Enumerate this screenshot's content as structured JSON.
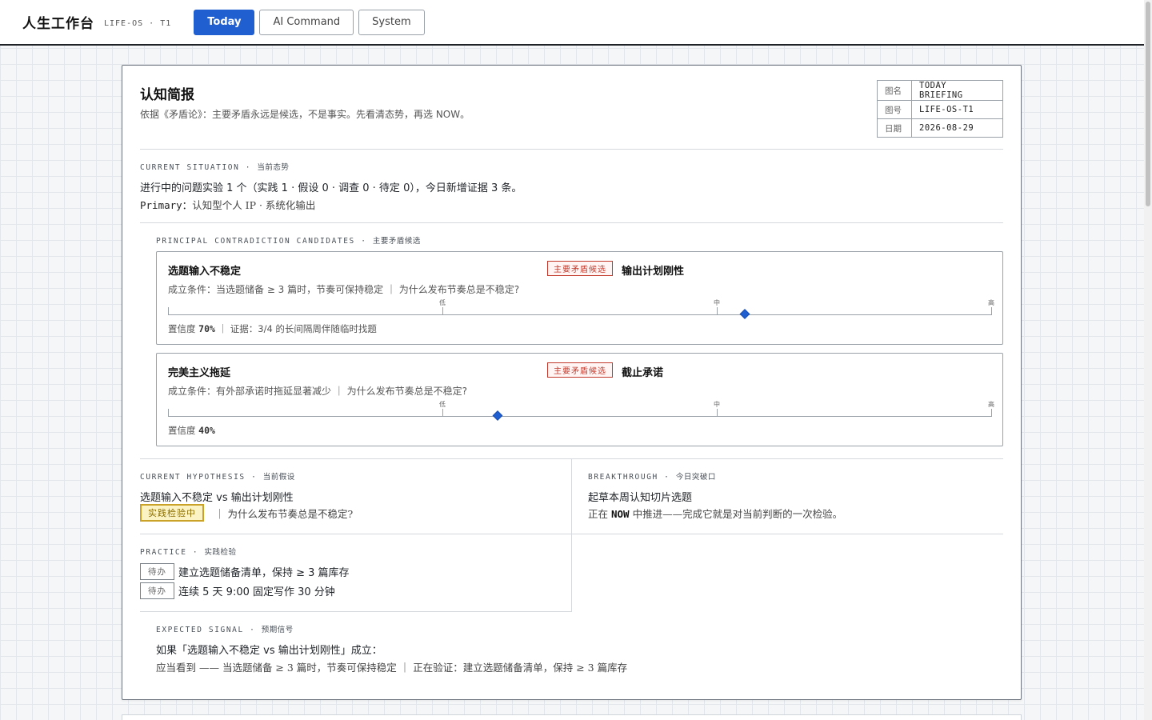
{
  "app": {
    "title": "人生工作台",
    "subtitle": "LIFE-OS · T1"
  },
  "tabs": [
    {
      "label": "Today",
      "active": true
    },
    {
      "label": "AI Command",
      "active": false
    },
    {
      "label": "System",
      "active": false
    }
  ],
  "briefing": {
    "title": "认知简报",
    "subtitle": "依据《矛盾论》：主要矛盾永远是候选，不是事实。先看清态势，再选 NOW。",
    "meta": [
      {
        "key": "图名",
        "value": "TODAY BRIEFING"
      },
      {
        "key": "图号",
        "value": "LIFE-OS-T1"
      },
      {
        "key": "日期",
        "value": "2026-08-29"
      }
    ]
  },
  "situation": {
    "label": "CURRENT SITUATION",
    "label_zh": "当前态势",
    "summary": "进行中的问题实验 1 个（实践 1 · 假设 0 · 调查 0 · 待定 0），今日新增证据 3 条。",
    "primary_key": "Primary：",
    "primary_value": "认知型个人 IP · 系统化输出"
  },
  "candidates": {
    "label": "PRINCIPAL CONTRADICTION CANDIDATES",
    "label_zh": "主要矛盾候选",
    "scale_labels": {
      "low": "低",
      "mid": "中",
      "high": "高"
    },
    "items": [
      {
        "side_a": "选题输入不稳定",
        "badge": "主要矛盾候选",
        "side_b": "输出计划刚性",
        "condition": "成立条件：当选题储备 ≥ 3 篇时，节奏可保持稳定 ｜ 为什么发布节奏总是不稳定?",
        "confidence_label": "置信度",
        "confidence": 0.7,
        "confidence_text": "70%",
        "evidence": "｜ 证据：3/4 的长间隔周伴随临时找题"
      },
      {
        "side_a": "完美主义拖延",
        "badge": "主要矛盾候选",
        "side_b": "截止承诺",
        "condition": "成立条件：有外部承诺时拖延显著减少 ｜ 为什么发布节奏总是不稳定?",
        "confidence_label": "置信度",
        "confidence": 0.4,
        "confidence_text": "40%",
        "evidence": ""
      }
    ]
  },
  "hypothesis": {
    "label": "CURRENT HYPOTHESIS",
    "label_zh": "当前假设",
    "text": "选题输入不稳定 vs 输出计划刚性",
    "status": "实践检验中",
    "question": "｜ 为什么发布节奏总是不稳定?"
  },
  "breakthrough": {
    "label": "BREAKTHROUGH",
    "label_zh": "今日突破口",
    "title": "起草本周认知切片选题",
    "note_pre": "正在",
    "note_now": "NOW",
    "note_post": "中推进——完成它就是对当前判断的一次检验。"
  },
  "practice": {
    "label": "PRACTICE",
    "label_zh": "实践检验",
    "items": [
      {
        "status": "待办",
        "text": "建立选题储备清单，保持 ≥ 3 篇库存"
      },
      {
        "status": "待办",
        "text": "连续 5 天 9:00 固定写作 30 分钟"
      }
    ]
  },
  "signal": {
    "label": "EXPECTED SIGNAL",
    "label_zh": "预期信号",
    "headline": "如果「选题输入不稳定 vs 输出计划刚性」成立：",
    "detail": "应当看到 —— 当选题储备 ≥ 3 篇时，节奏可保持稳定 ｜ 正在验证：建立选题储备清单，保持 ≥ 3 篇库存"
  },
  "colors": {
    "accent": "#1f5fd0",
    "badge_red": "#c0392b",
    "status_yellow": "#fbf3c4"
  }
}
